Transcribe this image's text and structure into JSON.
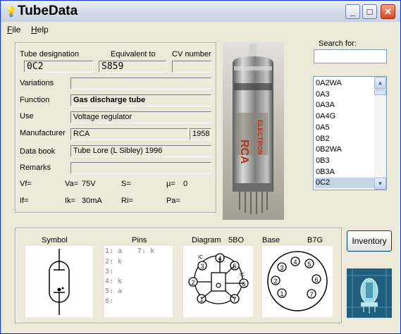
{
  "window": {
    "title": "TubeData"
  },
  "menu": [
    {
      "label": "File"
    },
    {
      "label": "Help"
    }
  ],
  "form": {
    "tube_designation_label": "Tube designation",
    "tube_designation": "0C2",
    "equivalent_label": "Equivalent to",
    "equivalent": "S859",
    "cv_label": "CV number",
    "cv": "",
    "variations_label": "Variations",
    "variations": "",
    "function_label": "Function",
    "function": "Gas discharge tube",
    "use_label": "Use",
    "use": "Voltage regulator",
    "manufacturer_label": "Manufacturer",
    "manufacturer": "RCA",
    "year": "1958",
    "databook_label": "Data book",
    "databook": "Tube Lore (L Sibley) 1996",
    "remarks_label": "Remarks",
    "remarks": ""
  },
  "params": {
    "vf_label": "Vf=",
    "vf": "",
    "va_label": "Va=",
    "va": "75V",
    "s_label": "S=",
    "s": "",
    "mu_label": "µ=",
    "mu": "0",
    "if_label": "If=",
    "if": "",
    "ik_label": "Ik=",
    "ik": "30mA",
    "ri_label": "Ri=",
    "ri": "",
    "pa_label": "Pa=",
    "pa": ""
  },
  "search": {
    "label": "Search for:",
    "value": ""
  },
  "tube_list": {
    "items": [
      "0A2WA",
      "0A3",
      "0A3A",
      "0A4G",
      "0A5",
      "0B2",
      "0B2WA",
      "0B3",
      "0B3A",
      "0C2"
    ],
    "selected": "0C2"
  },
  "diagrams": {
    "symbol_label": "Symbol",
    "pins_label": "Pins",
    "pins": [
      "1: a",
      "2: k",
      "3:",
      "4: k",
      "5: a",
      "6:"
    ],
    "pin7": "7: k",
    "diagram_label": "Diagram",
    "diagram_code": "5BO",
    "base_label": "Base",
    "base_code": "B7G",
    "diagram_ic_1": "IC",
    "diagram_ic_2": "IC",
    "pin_numbers": [
      "1",
      "2",
      "3",
      "4",
      "5",
      "6",
      "7"
    ]
  },
  "buttons": {
    "inventory": "Inventory"
  },
  "icons": {
    "app": "lightbulb-icon",
    "minimize": "minimize-icon",
    "maximize": "maximize-icon",
    "close": "close-icon"
  },
  "colors": {
    "title_bar_close": "#d8491f",
    "selection": "#c8d4e8"
  }
}
